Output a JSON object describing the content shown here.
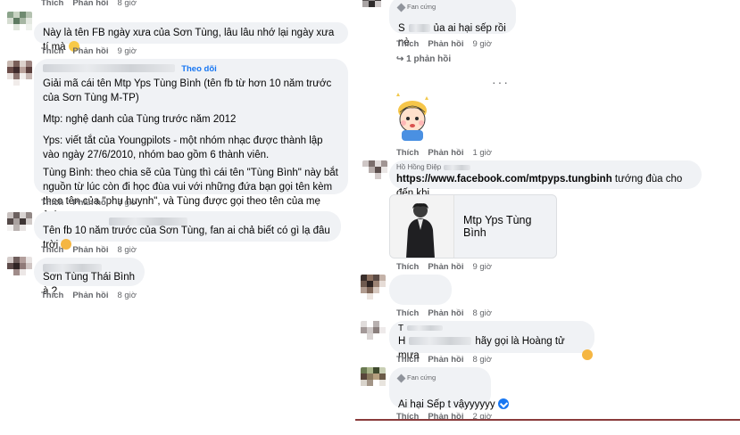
{
  "left": {
    "top_actions": {
      "like": "Thích",
      "reply": "Phản hồi",
      "time": "8 giờ"
    },
    "comments": [
      {
        "text": "Này là tên FB ngày xưa của Sơn Tùng, lâu lâu nhớ lại ngày xưa tí mà",
        "like": "Thích",
        "reply": "Phản hồi",
        "time": "9 giờ"
      },
      {
        "follow": "Theo dõi",
        "paragraphs": [
          "Giải mã cái tên Mtp Yps Tùng Bình (tên fb từ hơn 10 năm trước của Sơn Tùng M-TP)",
          "Mtp: nghệ danh của Tùng trước năm 2012",
          "Yps: viết tắt của Youngpilots - một nhóm nhạc được thành lập vào ngày 27/6/2010, nhóm bao gồm 6 thành viên.",
          "Tùng Bình: theo chia sẽ của Tùng thì cái tên \"Tùng Bình\" này bắt nguồn từ lúc còn đi học đùa vui với những đứa bạn gọi tên kèm theo tên của \"phụ huynh\", và Tùng được gọi theo tên của mẹ ảnh."
        ],
        "like": "Thích",
        "reply": "Phản hồi",
        "time": "8 giờ"
      },
      {
        "text": "Tên fb 10 năm trước của Sơn Tùng, fan ai chả biết có gì lạ đâu trời",
        "like": "Thích",
        "reply": "Phản hồi",
        "time": "8 giờ"
      },
      {
        "text": "Sơn Tùng Thái Bình à ?",
        "like": "Thích",
        "reply": "Phản hồi",
        "time": "8 giờ"
      }
    ]
  },
  "right": {
    "c1": {
      "fan_tag": "Fan cứng",
      "prefix": "S",
      "text": "ủa ai hại sếp rồi nè",
      "like": "Thích",
      "reply": "Phản hồi",
      "time": "9 giờ"
    },
    "replies_toggle": "↪ 1 phản hồi",
    "more": "···",
    "c2": {
      "like": "Thích",
      "reply": "Phản hồi",
      "time": "1 giờ"
    },
    "c3": {
      "name": "Hồ Hồng Điệp",
      "url": "https://www.facebook.com/mtpyps.tungbinh",
      "text": "tướng đùa cho đến khi",
      "preview_title": "Mtp Yps Tùng Bình",
      "like": "Thích",
      "reply": "Phản hồi",
      "time": "9 giờ"
    },
    "c4": {
      "like": "Thích",
      "reply": "Phản hồi",
      "time": "8 giờ"
    },
    "c5": {
      "line1_prefix": "T",
      "line2_prefix": "H",
      "text": "hãy gọi là Hoàng tử mưa",
      "like": "Thích",
      "reply": "Phản hồi",
      "time": "8 giờ"
    },
    "c6": {
      "fan_tag": "Fan cứng",
      "text": "Ai hại Sếp t vậyyyyyy",
      "like": "Thích",
      "reply": "Phản hồi",
      "time": "2 giờ"
    }
  },
  "colors": {
    "bubble": "#f0f2f5",
    "meta": "#65676b",
    "link_blue": "#1877f2"
  }
}
